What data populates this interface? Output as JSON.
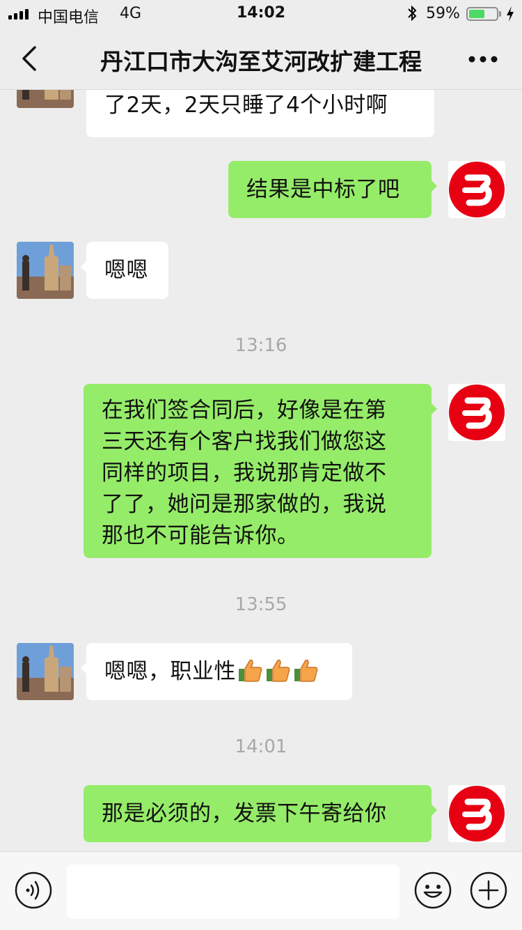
{
  "status_bar": {
    "carrier": "中国电信",
    "network": "4G",
    "time": "14:02",
    "battery_percent": "59%",
    "battery_level": 0.59
  },
  "nav": {
    "title": "丹江口市大沟至艾河改扩建工程",
    "back_icon": "chevron-left-icon",
    "more_icon": "more-dots-icon"
  },
  "messages": [
    {
      "side": "in",
      "text": "了2天，2天只睡了4个小时啊"
    },
    {
      "side": "out",
      "text": "结果是中标了吧"
    },
    {
      "side": "in",
      "text": "嗯嗯"
    },
    {
      "type": "time",
      "text": "13:16"
    },
    {
      "side": "out",
      "lines": [
        "在我们签合同后，好像是在第",
        "三天还有个客户找我们做您这",
        "同样的项目，我说那肯定做不",
        "了了，她问是那家做的，我说",
        "那也不可能告诉你。"
      ]
    },
    {
      "type": "time",
      "text": "13:55"
    },
    {
      "side": "in",
      "text": "嗯嗯，职业性",
      "emoji": "thumbs-up-icon",
      "emoji_count": 3
    },
    {
      "type": "time",
      "text": "14:01"
    },
    {
      "side": "out",
      "text": "那是必须的，发票下午寄给你"
    }
  ],
  "input_bar": {
    "voice_icon": "voice-icon",
    "emoji_icon": "emoji-icon",
    "plus_icon": "plus-icon"
  },
  "colors": {
    "background": "#ededed",
    "outgoing_bubble": "#95ec69",
    "incoming_bubble": "#ffffff",
    "logo_red": "#e60012",
    "battery_green": "#4cd964"
  }
}
